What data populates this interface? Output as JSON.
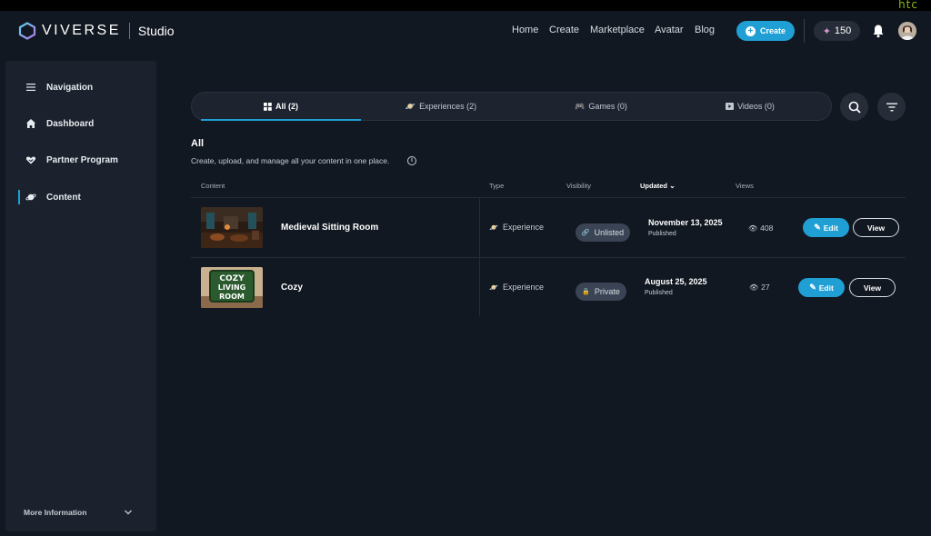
{
  "brand": {
    "corner_logo": "htc",
    "name": "VIVERSE",
    "product": "Studio"
  },
  "nav": {
    "links": [
      "Home",
      "Create",
      "Marketplace",
      "Avatar",
      "Blog"
    ],
    "create_label": "Create",
    "credits": "150",
    "bell_icon": "bell-icon",
    "avatar_icon": "user-avatar"
  },
  "sidebar": {
    "items": [
      {
        "label": "Navigation",
        "icon": "menu-icon"
      },
      {
        "label": "Dashboard",
        "icon": "home-icon"
      },
      {
        "label": "Partner Program",
        "icon": "handshake-icon"
      },
      {
        "label": "Content",
        "icon": "planet-icon"
      }
    ],
    "active_index": 3,
    "footer_label": "More Information"
  },
  "tabs": [
    {
      "label": "All (2)",
      "icon": "grid-icon"
    },
    {
      "label": "Experiences (2)",
      "icon": "planet-icon"
    },
    {
      "label": "Games (0)",
      "icon": "gamepad-icon"
    },
    {
      "label": "Videos (0)",
      "icon": "video-icon"
    }
  ],
  "active_tab": 0,
  "main": {
    "title": "All",
    "subtitle": "Create, upload, and manage all your content in one place.",
    "columns": [
      "Content",
      "Type",
      "Visibility",
      "Updated",
      "Views"
    ],
    "sorted_column": "Updated",
    "rows": [
      {
        "name": "Medieval Sitting Room",
        "type": "Experience",
        "visibility": "Unlisted",
        "date": "November 13, 2025",
        "status": "Published",
        "views": "408",
        "edit": "Edit",
        "view": "View"
      },
      {
        "name": "Cozy",
        "thumb_text": [
          "COZY",
          "LIVING",
          "ROOM"
        ],
        "type": "Experience",
        "visibility": "Private",
        "date": "August 25, 2025",
        "status": "Published",
        "views": "27",
        "edit": "Edit",
        "view": "View"
      }
    ]
  },
  "colors": {
    "background": "#121821",
    "sidebar": "#1b222d",
    "accent": "#1f9fd4",
    "htc_logo": "#8ab81a"
  }
}
